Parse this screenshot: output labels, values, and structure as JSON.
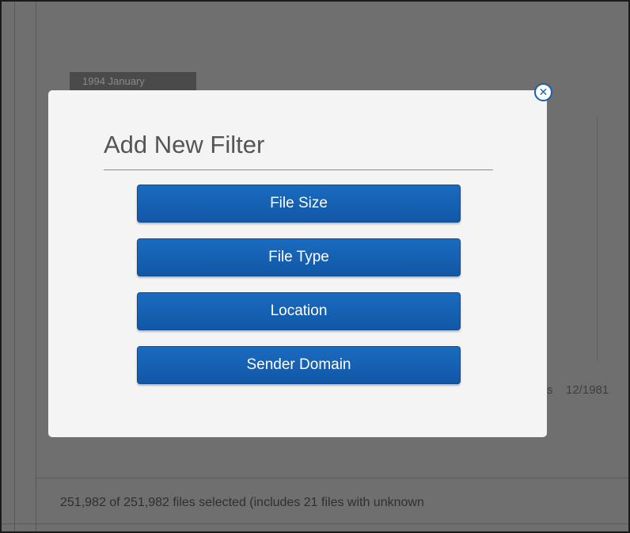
{
  "background": {
    "tag_text": "1994 January",
    "date_fragment": "s",
    "date_text": "12/1981",
    "status": "251,982 of 251,982 files selected  (includes 21 files with unknown"
  },
  "modal": {
    "title": "Add New Filter",
    "close_glyph": "✕",
    "buttons": [
      {
        "label": "File Size"
      },
      {
        "label": "File Type"
      },
      {
        "label": "Location"
      },
      {
        "label": "Sender Domain"
      }
    ]
  },
  "colors": {
    "button_blue": "#1a6bc0",
    "overlay_gray": "#6f6f6f",
    "modal_bg": "#f4f4f4"
  }
}
